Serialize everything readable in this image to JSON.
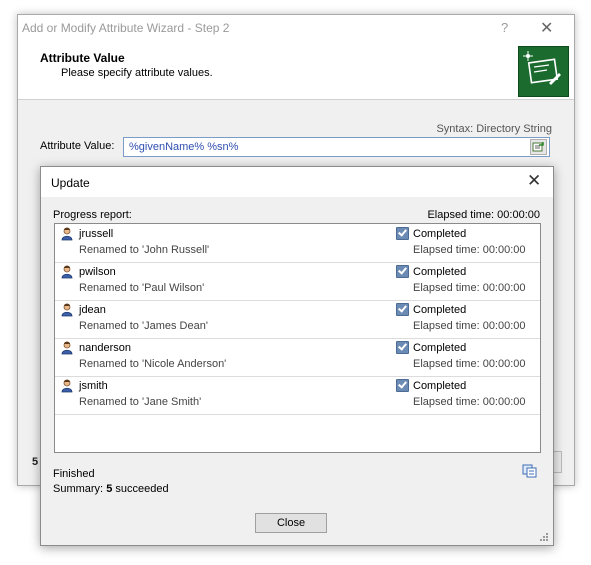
{
  "wizard": {
    "title": "Add or Modify Attribute Wizard - Step 2",
    "help": "?",
    "close": "✕",
    "header_title": "Attribute Value",
    "header_subtitle": "Please specify attribute values.",
    "syntax": "Syntax: Directory String",
    "attr_label": "Attribute Value:",
    "attr_value": "%givenName% %sn%",
    "partial_label": "5"
  },
  "update": {
    "title": "Update",
    "close": "✕",
    "progress_label": "Progress report:",
    "elapsed_total": "Elapsed time: 00:00:00",
    "rows": [
      {
        "user": "jrussell",
        "renamed": "Renamed to 'John Russell'",
        "status": "Completed",
        "elapsed": "Elapsed time: 00:00:00"
      },
      {
        "user": "pwilson",
        "renamed": "Renamed to 'Paul Wilson'",
        "status": "Completed",
        "elapsed": "Elapsed time: 00:00:00"
      },
      {
        "user": "jdean",
        "renamed": "Renamed to 'James Dean'",
        "status": "Completed",
        "elapsed": "Elapsed time: 00:00:00"
      },
      {
        "user": "nanderson",
        "renamed": "Renamed to 'Nicole Anderson'",
        "status": "Completed",
        "elapsed": "Elapsed time: 00:00:00"
      },
      {
        "user": "jsmith",
        "renamed": "Renamed to 'Jane Smith'",
        "status": "Completed",
        "elapsed": "Elapsed time: 00:00:00"
      }
    ],
    "finished": "Finished",
    "summary_label": "Summary:",
    "summary_count": "5",
    "summary_text": "succeeded",
    "close_button": "Close"
  },
  "colors": {
    "accent": "#1b6b2f",
    "link_text": "#2f4fb0",
    "check": "#6b8bb5"
  },
  "icons": [
    "user-icon",
    "checkbox-checked-icon",
    "copy-icon",
    "wizard-logo-icon",
    "picker-icon",
    "resize-grip-icon"
  ]
}
